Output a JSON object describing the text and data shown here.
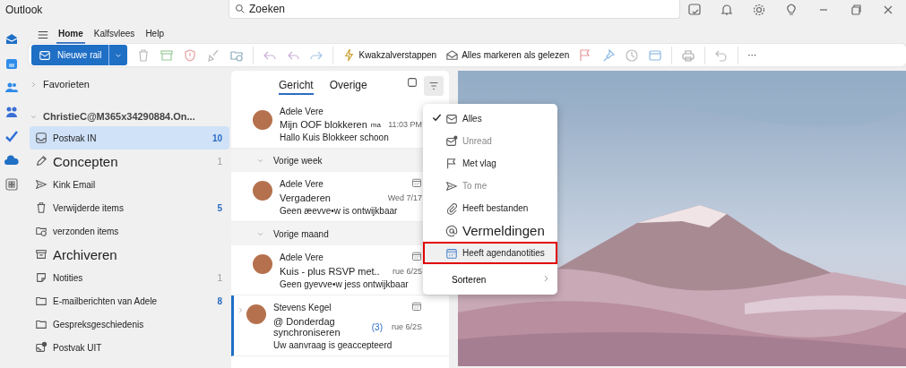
{
  "window": {
    "title": "Outlook"
  },
  "search": {
    "placeholder": "Zoeken"
  },
  "ribbon_tabs": [
    {
      "label": "Home",
      "selected": true
    },
    {
      "label": "Kalfsvlees",
      "selected": false
    },
    {
      "label": "Help",
      "selected": false
    }
  ],
  "toolbar": {
    "new_button": "Nieuwe rail",
    "sweep_label": "Kwakzalverstappen",
    "mark_read_label": "Alles markeren als gelezen",
    "more": "···"
  },
  "folders": {
    "favorites": "Favorieten",
    "account": "ChristieC@M365x34290884.On...",
    "items": [
      {
        "kind": "inbox",
        "label": "Postvak IN",
        "count": "10",
        "selected": true,
        "large": false,
        "count_bold": true
      },
      {
        "kind": "pencil",
        "label": "Concepten",
        "count": "1",
        "selected": false,
        "large": true,
        "count_bold": false
      },
      {
        "kind": "send",
        "label": "Kink Email",
        "selected": false,
        "large": false
      },
      {
        "kind": "trash",
        "label": "Verwijderde items",
        "count": "5",
        "selected": false,
        "large": false,
        "count_bold": true
      },
      {
        "kind": "folder-check",
        "label": "verzonden items",
        "selected": false,
        "large": false
      },
      {
        "kind": "archive",
        "label": "Archiveren",
        "selected": false,
        "large": true
      },
      {
        "kind": "note",
        "label": "Notities",
        "count": "1",
        "selected": false,
        "large": false,
        "count_bold": false
      },
      {
        "kind": "folder",
        "label": "E-mailberichten van Adele",
        "count": "8",
        "selected": false,
        "large": false,
        "count_bold": true
      },
      {
        "kind": "folder",
        "label": "Gespreksgeschiedenis",
        "selected": false,
        "large": false
      },
      {
        "kind": "outbox",
        "label": "Postvak UIT",
        "selected": false,
        "large": false
      }
    ]
  },
  "list_tabs": [
    {
      "label": "Gericht",
      "selected": true
    },
    {
      "label": "Overige",
      "selected": false
    }
  ],
  "messages": [
    {
      "kind": "message",
      "sender": "Adele Vere",
      "subject": "Mijn OOF blokkeren",
      "tag": "ma",
      "time": "11:03 PM",
      "preview": "Hallo Kuis Blokkeer schoon",
      "selected": false,
      "calendar": false
    },
    {
      "kind": "group",
      "label": "Vorige week"
    },
    {
      "kind": "message",
      "sender": "Adele Vere",
      "subject": "Vergaderen",
      "time": "Wed 7/17",
      "preview": "Geen æevve•w is ontwijkbaar",
      "selected": false,
      "calendar": true
    },
    {
      "kind": "group",
      "label": "Vorige maand"
    },
    {
      "kind": "message",
      "sender": "Adele Vere",
      "subject": "Kuis - plus RSVP met..",
      "time": "rue 6/25",
      "preview": "Geen gyevve•w jess ontwijkbaar",
      "selected": false,
      "calendar": true
    },
    {
      "kind": "message",
      "sender": "Stevens Kegel",
      "subject": "@ Donderdag synchroniseren",
      "count": "(3)",
      "time": "rue 6/2S",
      "preview": "Uw aanvraag is geaccepteerd",
      "selected": true,
      "calendar": true
    }
  ],
  "filter_menu": {
    "items": [
      {
        "kind": "mail",
        "label": "Alles",
        "checked": true,
        "disabled": false,
        "highlighted": false,
        "large": false
      },
      {
        "kind": "unread",
        "label": "Unread",
        "checked": false,
        "disabled": true,
        "highlighted": false,
        "large": false
      },
      {
        "kind": "flag",
        "label": "Met vlag",
        "checked": false,
        "disabled": false,
        "highlighted": false,
        "large": false
      },
      {
        "kind": "send",
        "label": "To me",
        "checked": false,
        "disabled": true,
        "highlighted": false,
        "large": false
      },
      {
        "kind": "clip",
        "label": "Heeft bestanden",
        "checked": false,
        "disabled": false,
        "highlighted": false,
        "large": false
      },
      {
        "kind": "at",
        "label": "Vermeldingen",
        "checked": false,
        "disabled": false,
        "highlighted": false,
        "large": true
      },
      {
        "kind": "calendar",
        "label": "Heeft agendanotities",
        "checked": false,
        "disabled": false,
        "highlighted": true,
        "large": false
      }
    ],
    "sort_label": "Sorteren"
  }
}
